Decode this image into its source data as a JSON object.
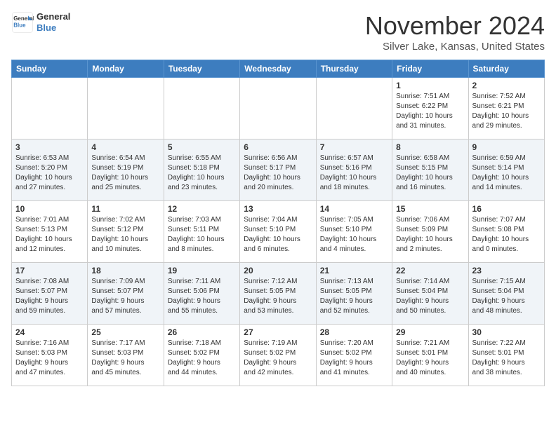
{
  "header": {
    "logo_line1": "General",
    "logo_line2": "Blue",
    "month": "November 2024",
    "location": "Silver Lake, Kansas, United States"
  },
  "weekdays": [
    "Sunday",
    "Monday",
    "Tuesday",
    "Wednesday",
    "Thursday",
    "Friday",
    "Saturday"
  ],
  "weeks": [
    [
      {
        "day": "",
        "info": ""
      },
      {
        "day": "",
        "info": ""
      },
      {
        "day": "",
        "info": ""
      },
      {
        "day": "",
        "info": ""
      },
      {
        "day": "",
        "info": ""
      },
      {
        "day": "1",
        "info": "Sunrise: 7:51 AM\nSunset: 6:22 PM\nDaylight: 10 hours\nand 31 minutes."
      },
      {
        "day": "2",
        "info": "Sunrise: 7:52 AM\nSunset: 6:21 PM\nDaylight: 10 hours\nand 29 minutes."
      }
    ],
    [
      {
        "day": "3",
        "info": "Sunrise: 6:53 AM\nSunset: 5:20 PM\nDaylight: 10 hours\nand 27 minutes."
      },
      {
        "day": "4",
        "info": "Sunrise: 6:54 AM\nSunset: 5:19 PM\nDaylight: 10 hours\nand 25 minutes."
      },
      {
        "day": "5",
        "info": "Sunrise: 6:55 AM\nSunset: 5:18 PM\nDaylight: 10 hours\nand 23 minutes."
      },
      {
        "day": "6",
        "info": "Sunrise: 6:56 AM\nSunset: 5:17 PM\nDaylight: 10 hours\nand 20 minutes."
      },
      {
        "day": "7",
        "info": "Sunrise: 6:57 AM\nSunset: 5:16 PM\nDaylight: 10 hours\nand 18 minutes."
      },
      {
        "day": "8",
        "info": "Sunrise: 6:58 AM\nSunset: 5:15 PM\nDaylight: 10 hours\nand 16 minutes."
      },
      {
        "day": "9",
        "info": "Sunrise: 6:59 AM\nSunset: 5:14 PM\nDaylight: 10 hours\nand 14 minutes."
      }
    ],
    [
      {
        "day": "10",
        "info": "Sunrise: 7:01 AM\nSunset: 5:13 PM\nDaylight: 10 hours\nand 12 minutes."
      },
      {
        "day": "11",
        "info": "Sunrise: 7:02 AM\nSunset: 5:12 PM\nDaylight: 10 hours\nand 10 minutes."
      },
      {
        "day": "12",
        "info": "Sunrise: 7:03 AM\nSunset: 5:11 PM\nDaylight: 10 hours\nand 8 minutes."
      },
      {
        "day": "13",
        "info": "Sunrise: 7:04 AM\nSunset: 5:10 PM\nDaylight: 10 hours\nand 6 minutes."
      },
      {
        "day": "14",
        "info": "Sunrise: 7:05 AM\nSunset: 5:10 PM\nDaylight: 10 hours\nand 4 minutes."
      },
      {
        "day": "15",
        "info": "Sunrise: 7:06 AM\nSunset: 5:09 PM\nDaylight: 10 hours\nand 2 minutes."
      },
      {
        "day": "16",
        "info": "Sunrise: 7:07 AM\nSunset: 5:08 PM\nDaylight: 10 hours\nand 0 minutes."
      }
    ],
    [
      {
        "day": "17",
        "info": "Sunrise: 7:08 AM\nSunset: 5:07 PM\nDaylight: 9 hours\nand 59 minutes."
      },
      {
        "day": "18",
        "info": "Sunrise: 7:09 AM\nSunset: 5:07 PM\nDaylight: 9 hours\nand 57 minutes."
      },
      {
        "day": "19",
        "info": "Sunrise: 7:11 AM\nSunset: 5:06 PM\nDaylight: 9 hours\nand 55 minutes."
      },
      {
        "day": "20",
        "info": "Sunrise: 7:12 AM\nSunset: 5:05 PM\nDaylight: 9 hours\nand 53 minutes."
      },
      {
        "day": "21",
        "info": "Sunrise: 7:13 AM\nSunset: 5:05 PM\nDaylight: 9 hours\nand 52 minutes."
      },
      {
        "day": "22",
        "info": "Sunrise: 7:14 AM\nSunset: 5:04 PM\nDaylight: 9 hours\nand 50 minutes."
      },
      {
        "day": "23",
        "info": "Sunrise: 7:15 AM\nSunset: 5:04 PM\nDaylight: 9 hours\nand 48 minutes."
      }
    ],
    [
      {
        "day": "24",
        "info": "Sunrise: 7:16 AM\nSunset: 5:03 PM\nDaylight: 9 hours\nand 47 minutes."
      },
      {
        "day": "25",
        "info": "Sunrise: 7:17 AM\nSunset: 5:03 PM\nDaylight: 9 hours\nand 45 minutes."
      },
      {
        "day": "26",
        "info": "Sunrise: 7:18 AM\nSunset: 5:02 PM\nDaylight: 9 hours\nand 44 minutes."
      },
      {
        "day": "27",
        "info": "Sunrise: 7:19 AM\nSunset: 5:02 PM\nDaylight: 9 hours\nand 42 minutes."
      },
      {
        "day": "28",
        "info": "Sunrise: 7:20 AM\nSunset: 5:02 PM\nDaylight: 9 hours\nand 41 minutes."
      },
      {
        "day": "29",
        "info": "Sunrise: 7:21 AM\nSunset: 5:01 PM\nDaylight: 9 hours\nand 40 minutes."
      },
      {
        "day": "30",
        "info": "Sunrise: 7:22 AM\nSunset: 5:01 PM\nDaylight: 9 hours\nand 38 minutes."
      }
    ]
  ]
}
